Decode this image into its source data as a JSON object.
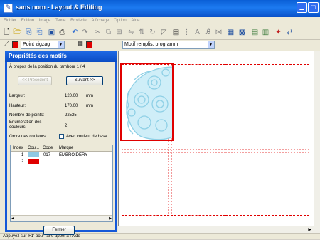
{
  "window": {
    "title": "sans nom - Layout & Editing",
    "controls": [
      "minimize-icon",
      "maximize-icon"
    ]
  },
  "menu": [
    "Fichier",
    "Edition",
    "Image",
    "Texte",
    "Broderie",
    "Affichage",
    "Option",
    "Aide"
  ],
  "toolbar2": {
    "stitch_combo": "Point zigzag",
    "fill_combo": "Motif remplis. programm",
    "stitch_color": "#e00000",
    "fill_color": "#e00000"
  },
  "dialog": {
    "title": "Propriétés des motifs",
    "hoop_position": "À propos de la position du tambour 1 / 4",
    "prev_label": "<< Précédent",
    "next_label": "Suivant >>",
    "width_label": "Largeur:",
    "width_value": "120.00",
    "width_unit": "mm",
    "height_label": "Hauteur:",
    "height_value": "170.00",
    "height_unit": "mm",
    "stitches_label": "Nombre de points:",
    "stitches_value": "22525",
    "colors_label": "Énumération des couleurs:",
    "colors_value": "2",
    "order_label": "Ordre des couleurs:",
    "with_base_label": "Avec couleur de base",
    "table": {
      "headers": [
        "Index",
        "Cou...",
        "Code",
        "Marque"
      ],
      "rows": [
        {
          "index": "1",
          "color": "#8fc9e3",
          "code": "017",
          "brand": "EMBROIDERY"
        },
        {
          "index": "2",
          "color": "#e00000",
          "code": "",
          "brand": ""
        }
      ]
    },
    "close_label": "Fermer"
  },
  "design": {
    "lace_color": "#8fd0e6",
    "hoop_color": "#e00000"
  },
  "status": "Appuyez sur 'F1' pour faire appel à l'Aide"
}
